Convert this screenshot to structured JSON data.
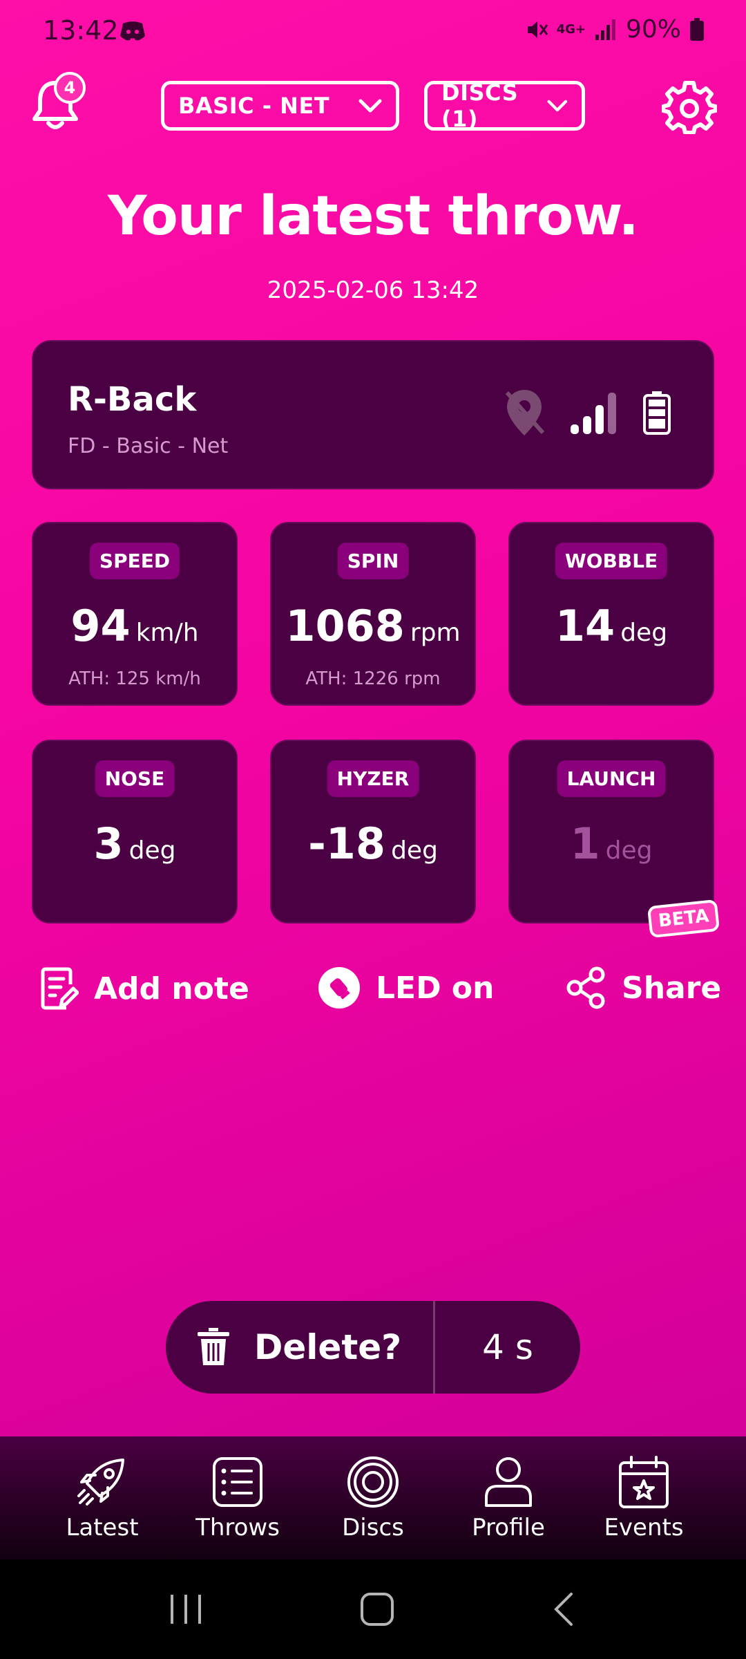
{
  "status": {
    "time": "13:42",
    "network": "4G+",
    "battery": "90%"
  },
  "header": {
    "notifications_count": "4",
    "mode_select": "BASIC - NET",
    "discs_select": "DISCS (1)"
  },
  "main": {
    "headline": "Your latest throw.",
    "datetime": "2025-02-06 13:42",
    "disc": {
      "name": "R-Back",
      "subtitle": "FD - Basic - Net"
    }
  },
  "metrics": [
    {
      "label": "SPEED",
      "value": "94",
      "unit": "km/h",
      "ath": "ATH: 125 km/h"
    },
    {
      "label": "SPIN",
      "value": "1068",
      "unit": "rpm",
      "ath": "ATH: 1226 rpm"
    },
    {
      "label": "WOBBLE",
      "value": "14",
      "unit": "deg",
      "ath": ""
    },
    {
      "label": "NOSE",
      "value": "3",
      "unit": "deg",
      "ath": ""
    },
    {
      "label": "HYZER",
      "value": "-18",
      "unit": "deg",
      "ath": ""
    },
    {
      "label": "LAUNCH",
      "value": "1",
      "unit": "deg",
      "ath": "",
      "badge": "BETA"
    }
  ],
  "actions": {
    "add_note": "Add note",
    "led": "LED on",
    "share": "Share"
  },
  "delete": {
    "label": "Delete?",
    "countdown": "4 s"
  },
  "nav": [
    {
      "label": "Latest",
      "icon": "rocket-icon"
    },
    {
      "label": "Throws",
      "icon": "list-icon"
    },
    {
      "label": "Discs",
      "icon": "disc-icon"
    },
    {
      "label": "Profile",
      "icon": "person-icon"
    },
    {
      "label": "Events",
      "icon": "calendar-star-icon"
    }
  ],
  "colors": {
    "background": "#f405a2",
    "card": "#4a0042",
    "label_chip": "#8a007a"
  }
}
